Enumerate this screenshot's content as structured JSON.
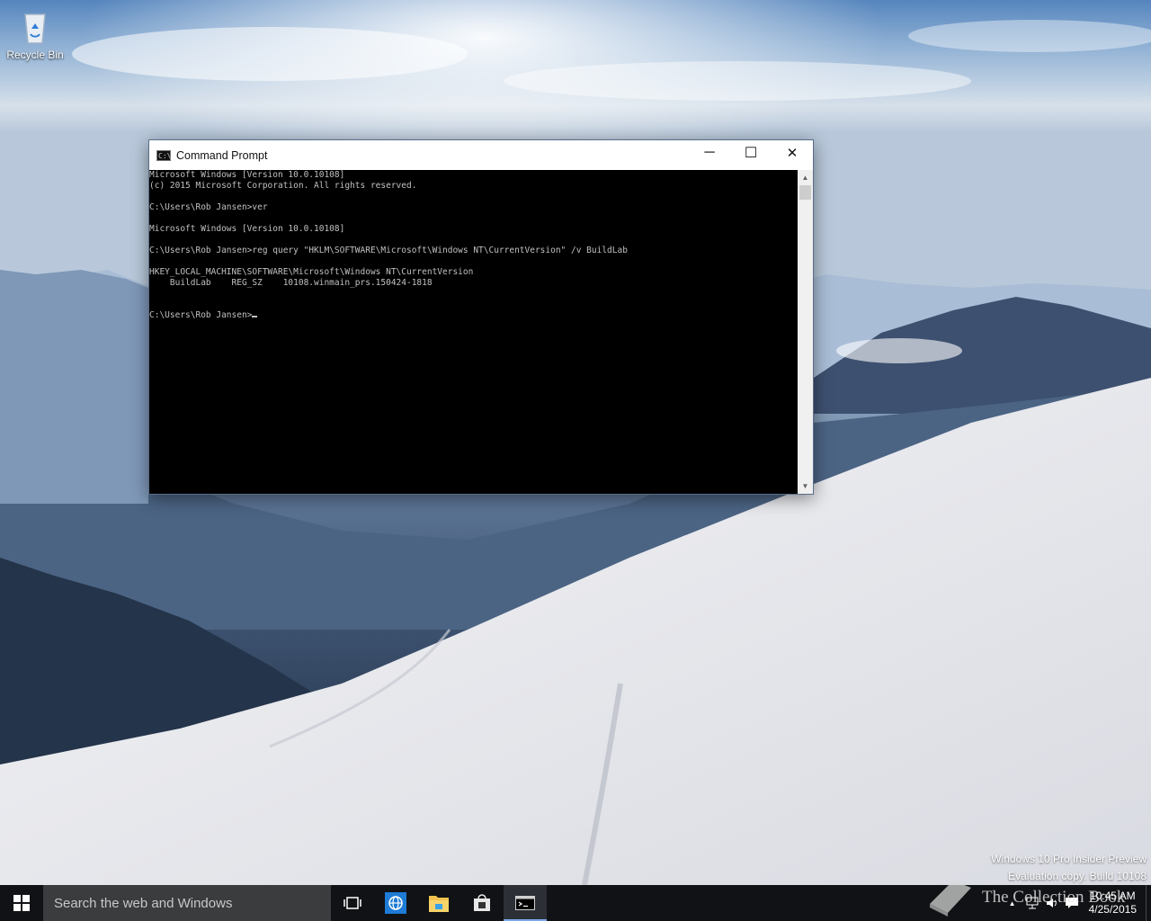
{
  "desktop": {
    "icons": [
      {
        "label": "Recycle Bin",
        "icon": "recycle-bin-icon"
      }
    ],
    "watermark": {
      "line1": "Windows 10 Pro Insider Preview",
      "line2": "Evaluation copy. Build 10108"
    },
    "overlay_text": "The Collection Book"
  },
  "window": {
    "title": "Command Prompt",
    "icon": "command-prompt-icon",
    "icon_text": "C:\\",
    "controls": {
      "minimize": "─",
      "maximize": "☐",
      "close": "✕"
    },
    "console_lines": [
      "Microsoft Windows [Version 10.0.10108]",
      "(c) 2015 Microsoft Corporation. All rights reserved.",
      "",
      "C:\\Users\\Rob Jansen>ver",
      "",
      "Microsoft Windows [Version 10.0.10108]",
      "",
      "C:\\Users\\Rob Jansen>reg query \"HKLM\\SOFTWARE\\Microsoft\\Windows NT\\CurrentVersion\" /v BuildLab",
      "",
      "HKEY_LOCAL_MACHINE\\SOFTWARE\\Microsoft\\Windows NT\\CurrentVersion",
      "    BuildLab    REG_SZ    10108.winmain_prs.150424-1818",
      "",
      ""
    ],
    "prompt": "C:\\Users\\Rob Jansen>",
    "scroll_up": "▲",
    "scroll_down": "▼"
  },
  "taskbar": {
    "search_placeholder": "Search the web and Windows",
    "apps": [
      {
        "name": "task-view",
        "icon": "task-view-icon"
      },
      {
        "name": "edge",
        "icon": "web-browser-icon"
      },
      {
        "name": "file-explorer",
        "icon": "folder-icon"
      },
      {
        "name": "store",
        "icon": "store-icon"
      },
      {
        "name": "command-prompt",
        "icon": "command-prompt-icon",
        "active": true
      }
    ],
    "tray": {
      "chevron": "▲",
      "time": "10:45 AM",
      "date": "4/25/2015"
    }
  },
  "colors": {
    "taskbar_bg": "#101215",
    "console_bg": "#000000",
    "console_fg": "#c0c0c0",
    "accent": "#7aa7e6"
  }
}
